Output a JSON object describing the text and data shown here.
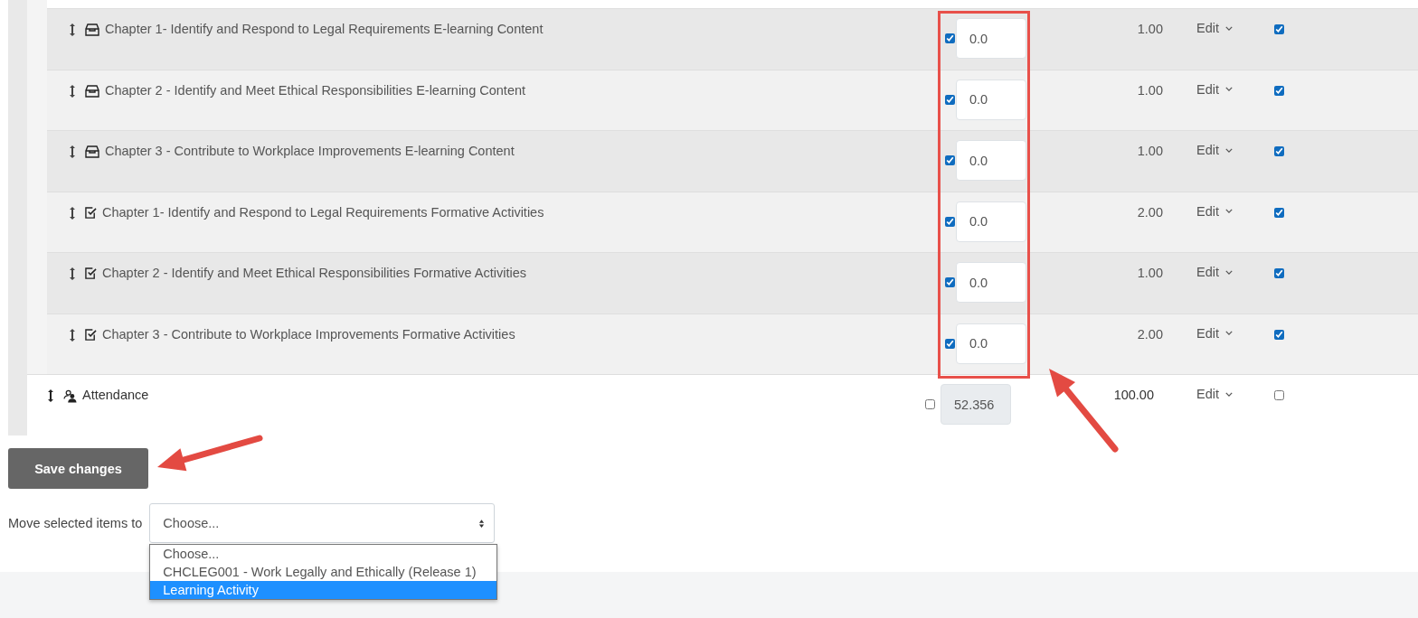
{
  "category_items": [
    {
      "kind": "content",
      "name": "Chapter 1- Identify and Respond to Legal Requirements E-learning Content",
      "override": true,
      "grade": "0.0",
      "weight": "1.00",
      "action": "Edit",
      "checked": true
    },
    {
      "kind": "content",
      "name": "Chapter 2 - Identify and Meet Ethical Responsibilities E-learning Content",
      "override": true,
      "grade": "0.0",
      "weight": "1.00",
      "action": "Edit",
      "checked": true
    },
    {
      "kind": "content",
      "name": "Chapter 3 - Contribute to Workplace Improvements E-learning Content",
      "override": true,
      "grade": "0.0",
      "weight": "1.00",
      "action": "Edit",
      "checked": true
    },
    {
      "kind": "quiz",
      "name": "Chapter 1- Identify and Respond to Legal Requirements Formative Activities",
      "override": true,
      "grade": "0.0",
      "weight": "2.00",
      "action": "Edit",
      "checked": true
    },
    {
      "kind": "quiz",
      "name": "Chapter 2 - Identify and Meet Ethical Responsibilities Formative Activities",
      "override": true,
      "grade": "0.0",
      "weight": "1.00",
      "action": "Edit",
      "checked": true
    },
    {
      "kind": "quiz",
      "name": "Chapter 3 - Contribute to Workplace Improvements Formative Activities",
      "override": true,
      "grade": "0.0",
      "weight": "2.00",
      "action": "Edit",
      "checked": true
    }
  ],
  "top_items": [
    {
      "kind": "attendance",
      "name": "Attendance",
      "override": false,
      "grade": "52.356",
      "weight": "100.00",
      "action": "Edit",
      "checked": false
    }
  ],
  "save_button": "Save changes",
  "move_to": {
    "label": "Move selected items to",
    "value": "Choose...",
    "options": [
      {
        "label": "Choose...",
        "highlighted": false
      },
      {
        "label": "CHCLEG001 - Work Legally and Ethically (Release 1)",
        "highlighted": false
      },
      {
        "label": "Learning Activity",
        "highlighted": true
      }
    ]
  }
}
